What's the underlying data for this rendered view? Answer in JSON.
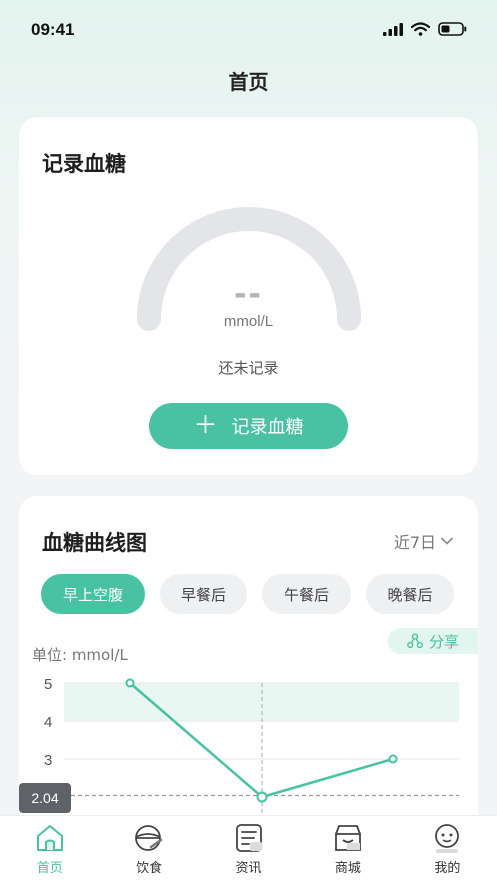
{
  "status_bar": {
    "time": "09:41"
  },
  "header": {
    "title": "首页"
  },
  "record_card": {
    "title": "记录血糖",
    "reading": "--",
    "unit": "mmol/L",
    "status": "还未记录",
    "button_label": "记录血糖"
  },
  "curve_card": {
    "title": "血糖曲线图",
    "range": "近7日",
    "tabs": [
      {
        "label": "早上空腹",
        "active": true
      },
      {
        "label": "早餐后",
        "active": false
      },
      {
        "label": "午餐后",
        "active": false
      },
      {
        "label": "晚餐后",
        "active": false
      }
    ],
    "share_label": "分享",
    "unit_label": "单位: mmol/L",
    "selected_value": "2.04"
  },
  "chart_data": {
    "type": "line",
    "y_ticks": [
      "5",
      "4",
      "3"
    ],
    "ylim": [
      2,
      5
    ],
    "x": [
      0,
      1,
      2
    ],
    "values": [
      5,
      2,
      3
    ],
    "target_range": [
      4,
      5
    ],
    "selected_value": 2.04,
    "colors": {
      "line": "#48c2a2",
      "band": "#e9f7f3"
    }
  },
  "tabbar": {
    "items": [
      {
        "label": "首页",
        "active": true,
        "icon": "home-icon"
      },
      {
        "label": "饮食",
        "active": false,
        "icon": "diet-bowl-icon"
      },
      {
        "label": "资讯",
        "active": false,
        "icon": "news-icon"
      },
      {
        "label": "商城",
        "active": false,
        "icon": "shop-icon"
      },
      {
        "label": "我的",
        "active": false,
        "icon": "profile-icon"
      }
    ]
  },
  "colors": {
    "accent": "#48c2a2",
    "gauge_track": "#e3e5e8"
  }
}
